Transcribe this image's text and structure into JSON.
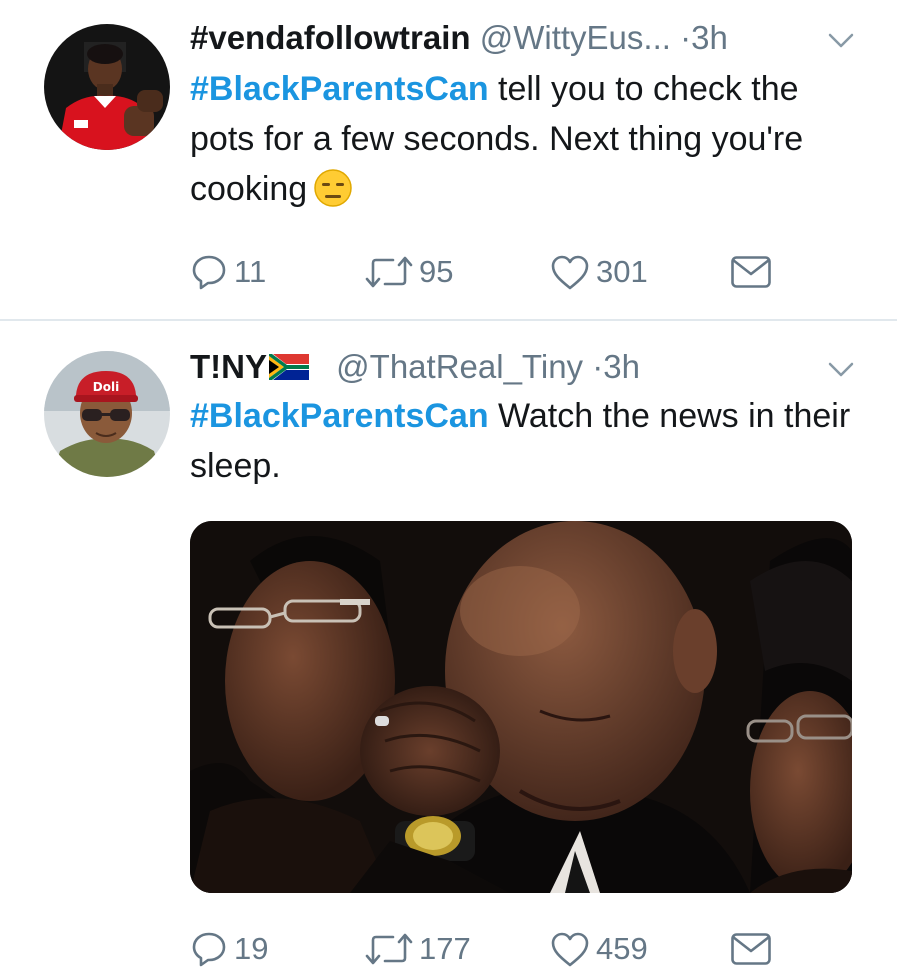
{
  "tweets": [
    {
      "name": "#vendafollowtrain",
      "handle": "@WittyEus...",
      "dot": "·",
      "time": "3h",
      "hashtag": "#BlackParentsCan",
      "text": " tell you to check the pots for a few seconds. Next thing you're cooking",
      "emoji": "expressionless-face",
      "counts": {
        "replies": "11",
        "retweets": "95",
        "likes": "301"
      }
    },
    {
      "name": "T!NY",
      "flag": "south-africa-flag",
      "handle": "@ThatReal_Tiny",
      "dot": "·",
      "time": "3h",
      "hashtag": "#BlackParentsCan",
      "text": " Watch the news in their sleep.",
      "counts": {
        "replies": "19",
        "retweets": "177",
        "likes": "459"
      }
    }
  ],
  "colors": {
    "hashtag": "#1b95e0",
    "muted": "#657786",
    "text": "#14171a",
    "divider": "#e1e8ed",
    "arsenal_red": "#d8121e",
    "cap_red": "#c81e28"
  },
  "icons": [
    "reply-icon",
    "retweet-icon",
    "like-icon",
    "direct-message-icon",
    "chevron-down-icon"
  ]
}
